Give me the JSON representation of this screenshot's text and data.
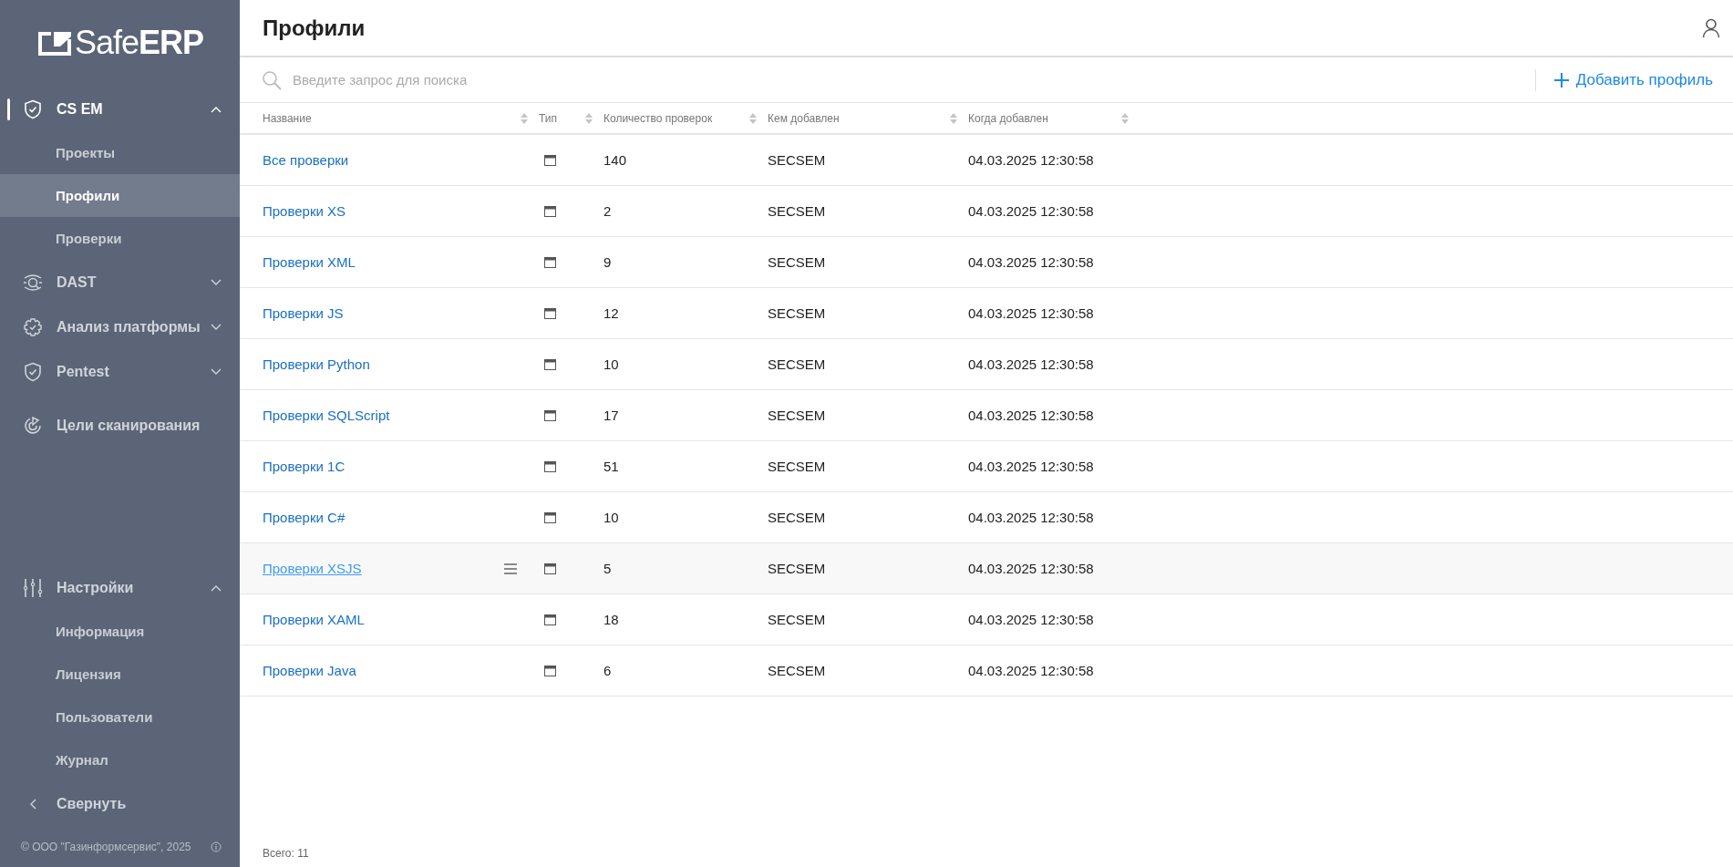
{
  "sidebar": {
    "logo": {
      "light": "Safe",
      "bold": "ERP"
    },
    "nav": [
      {
        "kind": "shield",
        "label": "CS EM",
        "active": true,
        "expanded": true,
        "children": [
          {
            "label": "Проекты",
            "selected": false
          },
          {
            "label": "Профили",
            "selected": true
          },
          {
            "label": "Проверки",
            "selected": false
          }
        ]
      },
      {
        "kind": "scan",
        "label": "DAST",
        "active": false,
        "expanded": false
      },
      {
        "kind": "gear",
        "label": "Анализ платформы",
        "active": false,
        "expanded": false
      },
      {
        "kind": "shield",
        "label": "Pentest",
        "active": false,
        "expanded": false
      },
      {
        "kind": "target",
        "label": "Цели сканирования",
        "active": false
      }
    ],
    "settings": [
      {
        "kind": "sliders",
        "label": "Настройки",
        "active": false,
        "expanded": true,
        "children": [
          {
            "label": "Информация",
            "selected": false
          },
          {
            "label": "Лицензия",
            "selected": false
          },
          {
            "label": "Пользователи",
            "selected": false
          },
          {
            "label": "Журнал",
            "selected": false
          }
        ]
      }
    ],
    "collapse": "Свернуть",
    "footer": "© ООО \"Газинформсервис\", 2025"
  },
  "header": {
    "title": "Профили"
  },
  "search": {
    "placeholder": "Введите запрос для поиска"
  },
  "add_button": "Добавить профиль",
  "table": {
    "columns": [
      "Название",
      "Тип",
      "Количество проверок",
      "Кем добавлен",
      "Когда добавлен"
    ],
    "rows": [
      {
        "name": "Все проверки",
        "count": "140",
        "added_by": "SECSEM",
        "added_at": "04.03.2025 12:30:58",
        "hovered": false
      },
      {
        "name": "Проверки XS",
        "count": "2",
        "added_by": "SECSEM",
        "added_at": "04.03.2025 12:30:58",
        "hovered": false
      },
      {
        "name": "Проверки XML",
        "count": "9",
        "added_by": "SECSEM",
        "added_at": "04.03.2025 12:30:58",
        "hovered": false
      },
      {
        "name": "Проверки JS",
        "count": "12",
        "added_by": "SECSEM",
        "added_at": "04.03.2025 12:30:58",
        "hovered": false
      },
      {
        "name": "Проверки Python",
        "count": "10",
        "added_by": "SECSEM",
        "added_at": "04.03.2025 12:30:58",
        "hovered": false
      },
      {
        "name": "Проверки SQLScript",
        "count": "17",
        "added_by": "SECSEM",
        "added_at": "04.03.2025 12:30:58",
        "hovered": false
      },
      {
        "name": "Проверки 1C",
        "count": "51",
        "added_by": "SECSEM",
        "added_at": "04.03.2025 12:30:58",
        "hovered": false
      },
      {
        "name": "Проверки C#",
        "count": "10",
        "added_by": "SECSEM",
        "added_at": "04.03.2025 12:30:58",
        "hovered": false
      },
      {
        "name": "Проверки XSJS",
        "count": "5",
        "added_by": "SECSEM",
        "added_at": "04.03.2025 12:30:58",
        "hovered": true
      },
      {
        "name": "Проверки XAML",
        "count": "18",
        "added_by": "SECSEM",
        "added_at": "04.03.2025 12:30:58",
        "hovered": false
      },
      {
        "name": "Проверки Java",
        "count": "6",
        "added_by": "SECSEM",
        "added_at": "04.03.2025 12:30:58",
        "hovered": false
      }
    ]
  },
  "total": "Всего: 11"
}
